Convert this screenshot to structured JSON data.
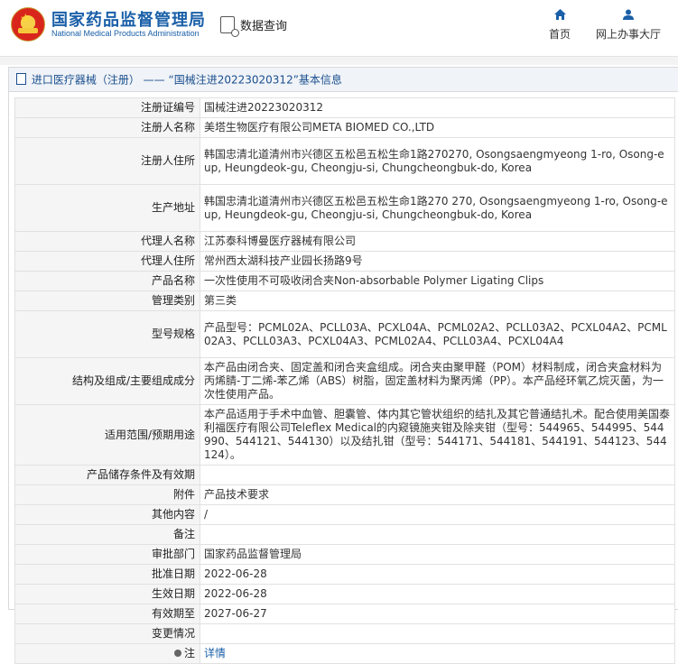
{
  "header": {
    "site_title_cn": "国家药品监督管理局",
    "site_title_en": "National Medical Products Administration",
    "data_query_label": "数据查询",
    "nav_home_label": "首页",
    "nav_hall_label": "网上办事大厅"
  },
  "breadcrumb": {
    "category": "进口医疗器械（注册）",
    "separator": "——",
    "record_title": "“国械注进20223020312”基本信息"
  },
  "record": {
    "rows": [
      {
        "label": "注册证编号",
        "value": "国械注进20223020312"
      },
      {
        "label": "注册人名称",
        "value": "美塔生物医疗有限公司META BIOMED CO.,LTD"
      },
      {
        "label": "注册人住所",
        "value": "韩国忠清北道清州市兴德区五松邑五松生命1路270270, Osongsaengmyeong 1-ro, Osong-eup, Heungdeok-gu, Cheongju-si, Chungcheongbuk-do, Korea"
      },
      {
        "label": "生产地址",
        "value": "韩国忠清北道清州市兴德区五松邑五松生命1路270 270, Osongsaengmyeong 1-ro, Osong-eup, Heungdeok-gu, Cheongju-si, Chungcheongbuk-do, Korea"
      },
      {
        "label": "代理人名称",
        "value": "江苏泰科博曼医疗器械有限公司"
      },
      {
        "label": "代理人住所",
        "value": "常州西太湖科技产业园长扬路9号"
      },
      {
        "label": "产品名称",
        "value": "一次性使用不可吸收闭合夹Non-absorbable Polymer Ligating Clips"
      },
      {
        "label": "管理类别",
        "value": "第三类"
      },
      {
        "label": "型号规格",
        "value": "产品型号：PCML02A、PCLL03A、PCXL04A、PCML02A2、PCLL03A2、PCXL04A2、PCML02A3、PCLL03A3、PCXL04A3、PCML02A4、PCLL03A4、PCXL04A4"
      },
      {
        "label": "结构及组成/主要组成成分",
        "value": "本产品由闭合夹、固定盖和闭合夹盒组成。闭合夹由聚甲醛（POM）材料制成，闭合夹盒材料为丙烯腈-丁二烯-苯乙烯（ABS）树脂，固定盖材料为聚丙烯（PP）。本产品经环氧乙烷灭菌，为一次性使用产品。"
      },
      {
        "label": "适用范围/预期用途",
        "value": "本产品适用于手术中血管、胆囊管、体内其它管状组织的结扎及其它普通结扎术。配合使用美国泰利福医疗有限公司Teleflex Medical的内窥镜施夹钳及除夹钳（型号：544965、544995、544990、544121、544130）以及结扎钳（型号：544171、544181、544191、544123、544124）。"
      },
      {
        "label": "产品储存条件及有效期",
        "value": ""
      },
      {
        "label": "附件",
        "value": "产品技术要求"
      },
      {
        "label": "其他内容",
        "value": "/"
      },
      {
        "label": "备注",
        "value": ""
      },
      {
        "label": "审批部门",
        "value": "国家药品监督管理局"
      },
      {
        "label": "批准日期",
        "value": "2022-06-28"
      },
      {
        "label": "生效日期",
        "value": "2022-06-28"
      },
      {
        "label": "有效期至",
        "value": "2027-06-27"
      },
      {
        "label": "变更情况",
        "value": ""
      },
      {
        "label": "注",
        "value": "详情"
      }
    ]
  },
  "colors": {
    "brand_blue": "#1a5fa8",
    "label_bg": "#f5f5f5",
    "border": "#e1e1e1"
  },
  "icons": {
    "logo": "national-emblem-icon",
    "query": "data-query-icon",
    "home": "home-icon",
    "hall": "user-icon",
    "breadcrumb": "document-icon",
    "note": "note-dot-icon"
  }
}
